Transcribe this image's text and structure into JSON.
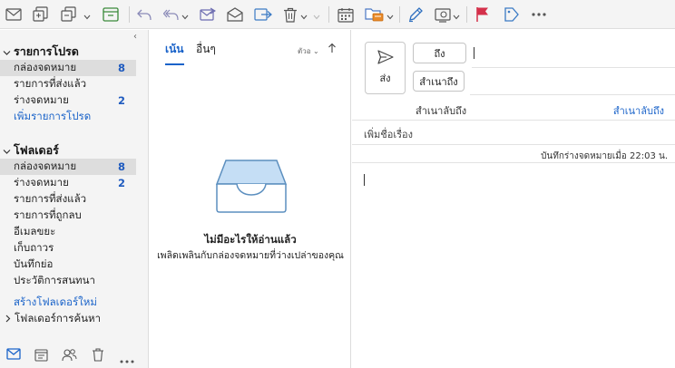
{
  "toolbar": {
    "icons": [
      "mail-icon",
      "new-items-icon",
      "copy-icon",
      "archive-icon",
      "undo-icon",
      "undo-all-icon",
      "forward-icon",
      "open-mail-icon",
      "move-icon",
      "delete-icon",
      "calendar-icon",
      "folder-move-icon",
      "pen-icon",
      "screenshot-icon",
      "flag-icon",
      "tag-icon",
      "more-icon"
    ]
  },
  "sidebar": {
    "favorites_title": "รายการโปรด",
    "favorites": [
      {
        "label": "กล่องจดหมาย",
        "count": "8"
      },
      {
        "label": "รายการที่ส่งแล้ว",
        "count": ""
      },
      {
        "label": "ร่างจดหมาย",
        "count": "2"
      }
    ],
    "add_favorite": "เพิ่มรายการโปรด",
    "folders_title": "โฟลเดอร์",
    "folders": [
      {
        "label": "กล่องจดหมาย",
        "count": "8"
      },
      {
        "label": "ร่างจดหมาย",
        "count": "2"
      },
      {
        "label": "รายการที่ส่งแล้ว",
        "count": ""
      },
      {
        "label": "รายการที่ถูกลบ",
        "count": ""
      },
      {
        "label": "อีเมลขยะ",
        "count": ""
      },
      {
        "label": "เก็บถาวร",
        "count": ""
      },
      {
        "label": "บันทึกย่อ",
        "count": ""
      },
      {
        "label": "ประวัติการสนทนา",
        "count": ""
      }
    ],
    "new_folder": "สร้างโฟลเดอร์ใหม่",
    "search_folders": "โฟลเดอร์การค้นหา",
    "bottom_icons": [
      "mail-icon",
      "calendar-icon",
      "people-icon",
      "delete-icon",
      "more-icon"
    ]
  },
  "message_list": {
    "tab_focused": "เน้น",
    "tab_other": "อื่นๆ",
    "sort_label": "ตัวอ",
    "empty_title": "ไม่มีอะไรให้อ่านแล้ว",
    "empty_subtitle": "เพลิดเพลินกับกล่องจดหมายที่ว่างเปล่าของคุณ"
  },
  "compose": {
    "send_label": "ส่ง",
    "to_label": "ถึง",
    "cc_label": "สำเนาถึง",
    "bcc_label": "สำเนาลับถึง",
    "bcc_link": "สำเนาลับถึง",
    "subject_placeholder": "เพิ่มชื่อเรื่อง",
    "saved_status": "บันทึกร่างจดหมายเมื่อ 22:03 น."
  },
  "colors": {
    "accent": "#1a63c9",
    "flag": "#d4304a"
  }
}
